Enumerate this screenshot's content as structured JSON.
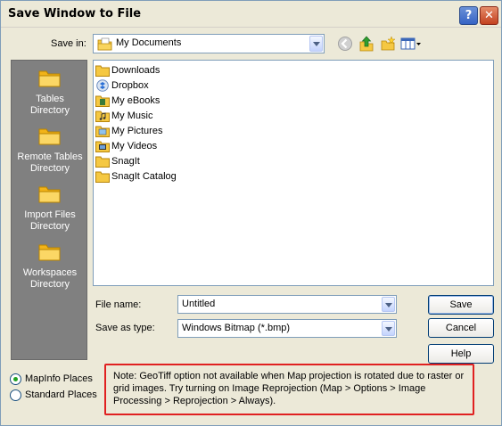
{
  "window": {
    "title": "Save Window to File",
    "help_glyph": "?",
    "close_glyph": "✕"
  },
  "save_in": {
    "label": "Save in:",
    "value": "My Documents"
  },
  "toolbar": {
    "icons": [
      "back-icon",
      "up-folder-icon",
      "new-folder-icon",
      "views-menu-icon"
    ]
  },
  "places": [
    {
      "label_1": "Tables",
      "label_2": "Directory",
      "icon": "folder-icon"
    },
    {
      "label_1": "Remote Tables",
      "label_2": "Directory",
      "icon": "folder-icon"
    },
    {
      "label_1": "Import Files",
      "label_2": "Directory",
      "icon": "folder-icon"
    },
    {
      "label_1": "Workspaces",
      "label_2": "Directory",
      "icon": "folder-icon"
    }
  ],
  "files": [
    {
      "name": "Downloads",
      "icon": "folder-icon"
    },
    {
      "name": "Dropbox",
      "icon": "dropbox-folder-icon"
    },
    {
      "name": "My eBooks",
      "icon": "ebooks-folder-icon"
    },
    {
      "name": "My Music",
      "icon": "music-folder-icon"
    },
    {
      "name": "My Pictures",
      "icon": "pictures-folder-icon"
    },
    {
      "name": "My Videos",
      "icon": "videos-folder-icon"
    },
    {
      "name": "SnagIt",
      "icon": "folder-icon"
    },
    {
      "name": "SnagIt Catalog",
      "icon": "folder-icon"
    }
  ],
  "file_name": {
    "label": "File name:",
    "value": "Untitled"
  },
  "save_as_type": {
    "label": "Save as type:",
    "value": "Windows Bitmap (*.bmp)"
  },
  "buttons": {
    "save": "Save",
    "cancel": "Cancel",
    "help": "Help"
  },
  "places_mode": {
    "mapinfo": "MapInfo Places",
    "standard": "Standard Places",
    "selected": "mapinfo"
  },
  "note": "Note: GeoTiff option not available when Map projection is rotated due to raster or grid images. Try turning on Image Reprojection (Map > Options > Image Processing > Reprojection > Always).",
  "colors": {
    "dialog_bg": "#ECE9D8",
    "places_bg": "#808080",
    "note_border": "#E02020",
    "folder": "#F5C842"
  }
}
